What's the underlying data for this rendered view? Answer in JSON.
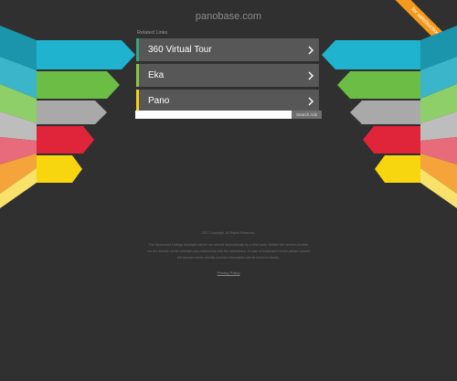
{
  "header": {
    "site_name": "panobase.com"
  },
  "ribbon": {
    "label": "for sale/auction",
    "color": "#f39a1e"
  },
  "related": {
    "title": "Related Links",
    "links": [
      {
        "label": "360 Virtual Tour",
        "accent": "#3aa07a"
      },
      {
        "label": "Eka",
        "accent": "#8cc63f"
      },
      {
        "label": "Pano",
        "accent": "#f2cf1a"
      }
    ]
  },
  "search": {
    "placeholder": "",
    "button_label": "Search Ads"
  },
  "footer": {
    "line1": "2017 Copyright. All Rights Reserved.",
    "line2": "The Sponsored Listings displayed above are served automatically by a third party. Neither the service provider nor the domain owner maintain any relationship with the advertisers. In case of trademark issues please contact the domain owner directly (contact information can be found in whois).",
    "privacy_label": "Privacy Policy"
  },
  "colors": {
    "background": "#303030",
    "link_row": "#575757",
    "arrow_cyan": "#1fb3cf",
    "arrow_green": "#6cbd45",
    "arrow_grey": "#a9a9a9",
    "arrow_red": "#e0243a",
    "arrow_yellow": "#f7d50f"
  }
}
